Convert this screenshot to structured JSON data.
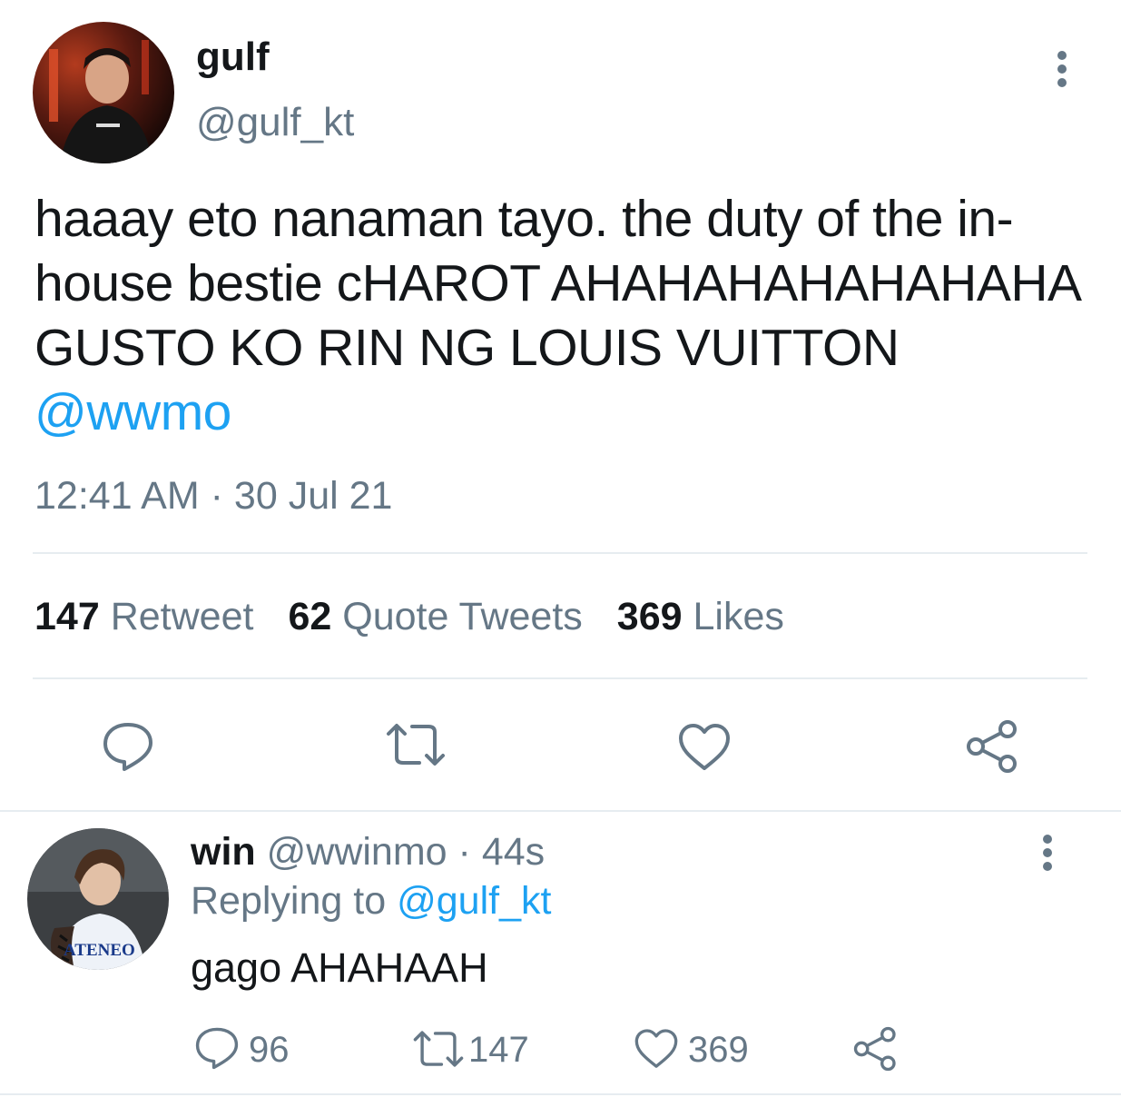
{
  "main_tweet": {
    "display_name": "gulf",
    "handle": "@gulf_kt",
    "text": "haaay eto nanaman tayo. the duty of the in-house bestie cHAROT AHAHAHAHAHAHAHA GUSTO KO RIN NG LOUIS VUITTON",
    "mention": "@wwmo",
    "time": "12:41 AM",
    "separator": "·",
    "date": "30 Jul 21",
    "stats": {
      "retweets_count": "147",
      "retweets_label": "Retweet",
      "quotes_count": "62",
      "quotes_label": "Quote Tweets",
      "likes_count": "369",
      "likes_label": "Likes"
    }
  },
  "reply": {
    "display_name": "win",
    "handle": "@wwinmo",
    "separator": "·",
    "age": "44s",
    "replying_prefix": "Replying to",
    "replying_to": "@gulf_kt",
    "text": "gago AHAHAAH",
    "avatar_jersey_text": "ATENEO",
    "reply_count": "96",
    "retweet_count": "147",
    "like_count": "369"
  },
  "colors": {
    "accent": "#1da1f2",
    "muted": "#657786",
    "divider": "#e6ecf0"
  },
  "icons": [
    "more-vertical-icon",
    "reply-icon",
    "retweet-icon",
    "like-icon",
    "share-icon"
  ]
}
